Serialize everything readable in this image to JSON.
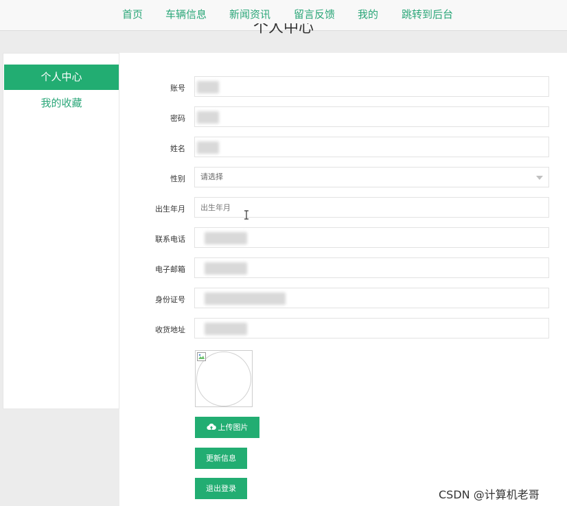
{
  "nav": {
    "items": [
      "首页",
      "车辆信息",
      "新闻资讯",
      "留言反馈",
      "我的",
      "跳转到后台"
    ]
  },
  "page_title": "个人中心",
  "sidebar": {
    "items": [
      {
        "label": "个人中心",
        "active": true
      },
      {
        "label": "我的收藏",
        "active": false
      }
    ]
  },
  "form": {
    "account_label": "账号",
    "password_label": "密码",
    "name_label": "姓名",
    "gender_label": "性别",
    "gender_placeholder": "请选择",
    "birth_label": "出生年月",
    "birth_placeholder": "出生年月",
    "phone_label": "联系电话",
    "email_label": "电子邮箱",
    "idcard_label": "身份证号",
    "address_label": "收货地址"
  },
  "buttons": {
    "upload": "上传图片",
    "update": "更新信息",
    "logout": "退出登录"
  },
  "watermark": "CSDN @计算机老哥",
  "colors": {
    "accent": "#22ad72",
    "nav_text": "#2aa678"
  }
}
